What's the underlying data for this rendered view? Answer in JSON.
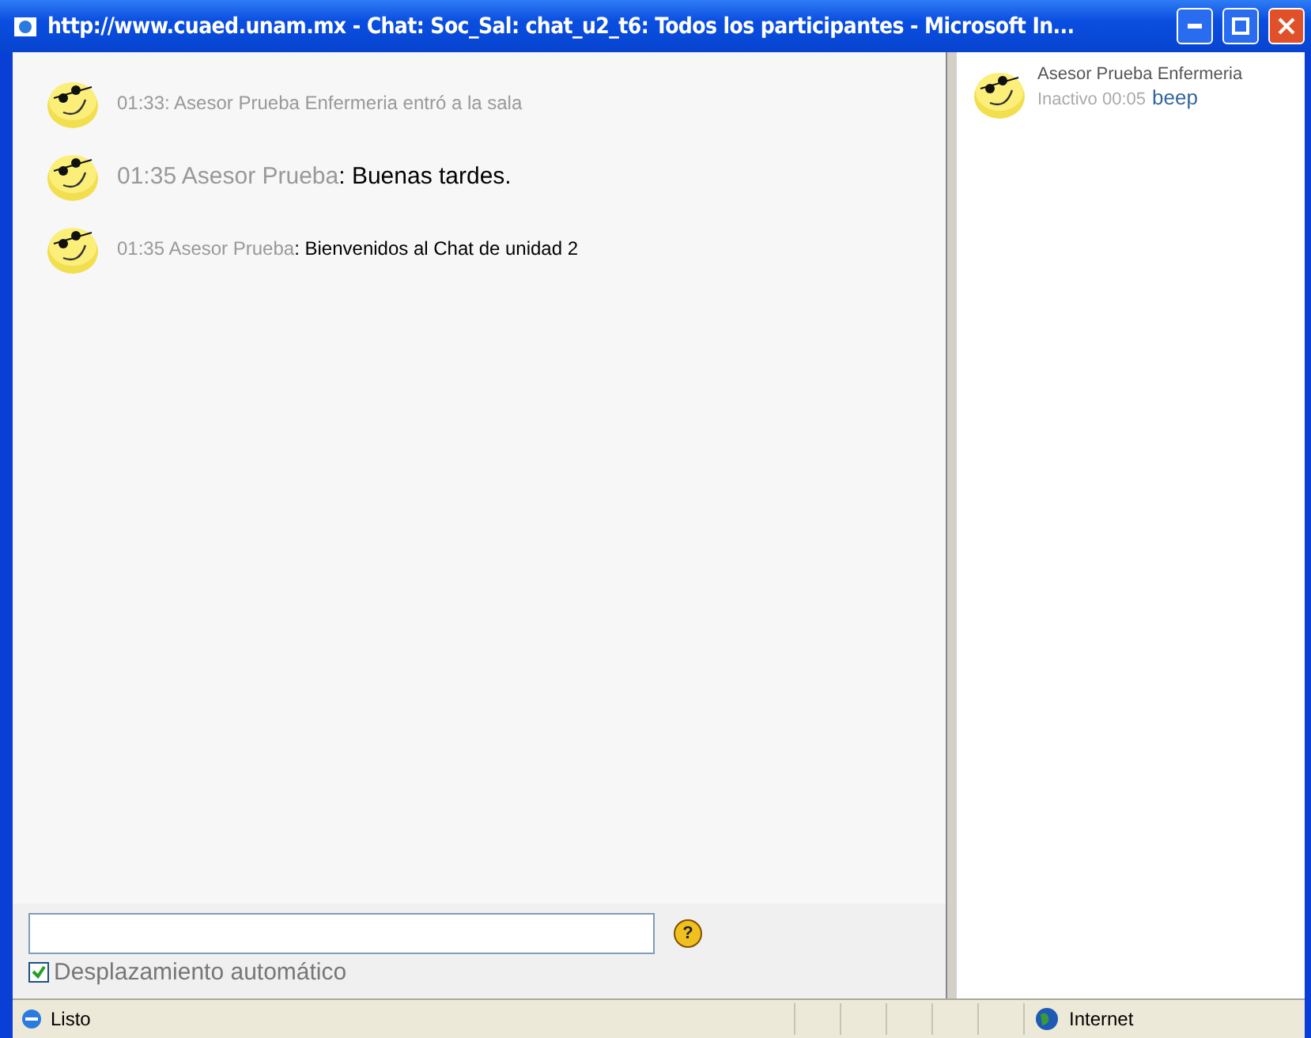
{
  "window": {
    "title": "http://www.cuaed.unam.mx - Chat: Soc_Sal: chat_u2_t6: Todos los participantes - Microsoft In..."
  },
  "messages": [
    {
      "kind": "system",
      "meta": "01:33: Asesor Prueba Enfermeria entró a la sala"
    },
    {
      "kind": "large",
      "meta": "01:35 Asesor Prueba",
      "text": ": Buenas tardes."
    },
    {
      "kind": "normal",
      "meta": "01:35 Asesor Prueba",
      "text": ": Bienvenidos al Chat de unidad 2"
    }
  ],
  "users": [
    {
      "name": "Asesor Prueba Enfermeria",
      "status": "Inactivo 00:05",
      "action": "beep"
    }
  ],
  "input": {
    "help": "?"
  },
  "autoscroll": {
    "label": "Desplazamiento automático",
    "checked": true
  },
  "status_bar": {
    "text": "Listo",
    "zone": "Internet"
  }
}
